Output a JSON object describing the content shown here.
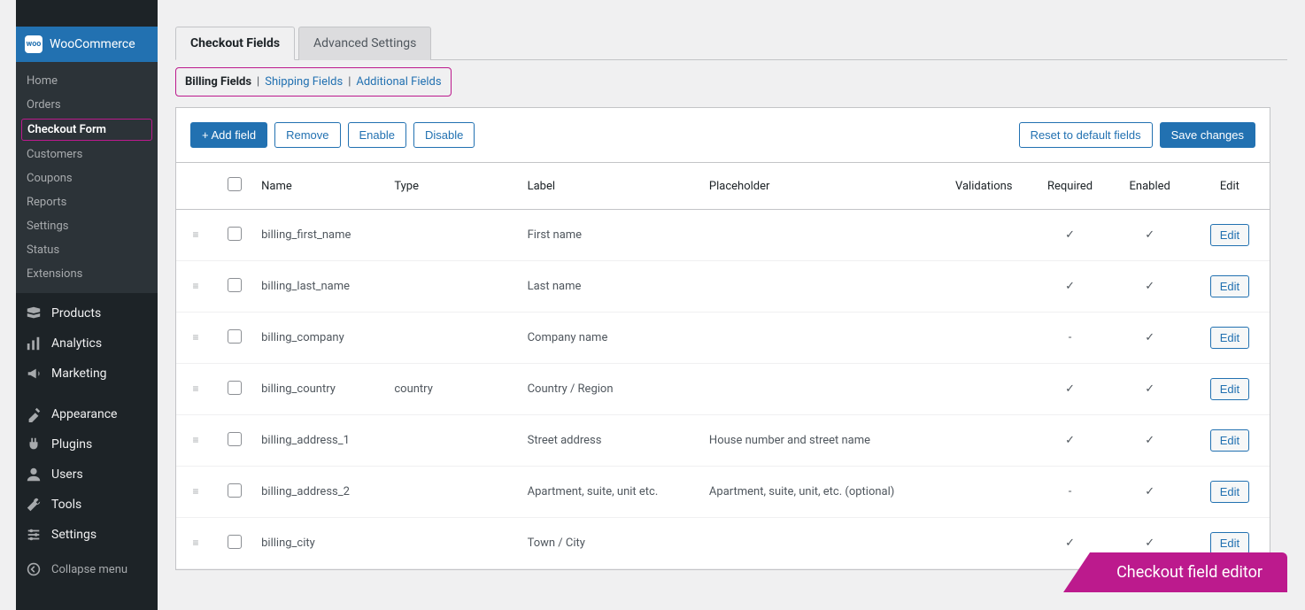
{
  "sidebar": {
    "brand": "WooCommerce",
    "submenu": [
      {
        "label": "Home",
        "active": false
      },
      {
        "label": "Orders",
        "active": false
      },
      {
        "label": "Checkout Form",
        "active": true
      },
      {
        "label": "Customers",
        "active": false
      },
      {
        "label": "Coupons",
        "active": false
      },
      {
        "label": "Reports",
        "active": false
      },
      {
        "label": "Settings",
        "active": false
      },
      {
        "label": "Status",
        "active": false
      },
      {
        "label": "Extensions",
        "active": false
      }
    ],
    "menu": [
      {
        "label": "Products",
        "icon": "products-icon"
      },
      {
        "label": "Analytics",
        "icon": "analytics-icon"
      },
      {
        "label": "Marketing",
        "icon": "marketing-icon"
      }
    ],
    "menu2": [
      {
        "label": "Appearance",
        "icon": "appearance-icon"
      },
      {
        "label": "Plugins",
        "icon": "plugins-icon"
      },
      {
        "label": "Users",
        "icon": "users-icon"
      },
      {
        "label": "Tools",
        "icon": "tools-icon"
      },
      {
        "label": "Settings",
        "icon": "settings-icon"
      }
    ],
    "collapse": "Collapse menu"
  },
  "tabs": [
    {
      "label": "Checkout Fields",
      "active": true
    },
    {
      "label": "Advanced Settings",
      "active": false
    }
  ],
  "subtabs": {
    "billing": "Billing Fields",
    "shipping": "Shipping Fields",
    "additional": "Additional Fields"
  },
  "toolbar": {
    "add": "+ Add field",
    "remove": "Remove",
    "enable": "Enable",
    "disable": "Disable",
    "reset": "Reset to default fields",
    "save": "Save changes"
  },
  "columns": {
    "name": "Name",
    "type": "Type",
    "label": "Label",
    "placeholder": "Placeholder",
    "validations": "Validations",
    "required": "Required",
    "enabled": "Enabled",
    "edit": "Edit"
  },
  "rows": [
    {
      "name": "billing_first_name",
      "type": "",
      "label": "First name",
      "placeholder": "",
      "required": true,
      "enabled": true
    },
    {
      "name": "billing_last_name",
      "type": "",
      "label": "Last name",
      "placeholder": "",
      "required": true,
      "enabled": true
    },
    {
      "name": "billing_company",
      "type": "",
      "label": "Company name",
      "placeholder": "",
      "required": false,
      "enabled": true
    },
    {
      "name": "billing_country",
      "type": "country",
      "label": "Country / Region",
      "placeholder": "",
      "required": true,
      "enabled": true
    },
    {
      "name": "billing_address_1",
      "type": "",
      "label": "Street address",
      "placeholder": "House number and street name",
      "required": true,
      "enabled": true
    },
    {
      "name": "billing_address_2",
      "type": "",
      "label": "Apartment, suite, unit etc.",
      "placeholder": "Apartment, suite, unit, etc. (optional)",
      "required": false,
      "enabled": true
    },
    {
      "name": "billing_city",
      "type": "",
      "label": "Town / City",
      "placeholder": "",
      "required": true,
      "enabled": true
    }
  ],
  "edit_label": "Edit",
  "banner": "Checkout field editor"
}
